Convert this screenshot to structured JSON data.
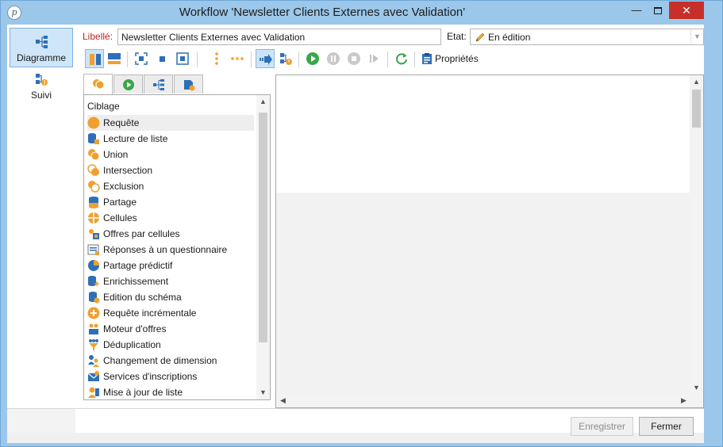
{
  "window": {
    "title": "Workflow 'Newsletter Clients Externes avec Validation'",
    "close_glyph": "✕",
    "minimize_glyph": "—",
    "app_icon_glyph": "p"
  },
  "leftnav": {
    "items": [
      {
        "label": "Diagramme",
        "icon": "workflow-diagram-icon",
        "active": true
      },
      {
        "label": "Suivi",
        "icon": "tracking-icon",
        "active": false
      }
    ]
  },
  "header": {
    "libelle_label": "Libellé:",
    "libelle_value": "Newsletter Clients Externes avec Validation",
    "etat_label": "Etat:",
    "etat_value": "En édition",
    "etat_icon": "pencil-icon"
  },
  "toolbar": {
    "properties_label": "Propriétés",
    "buttons": [
      "vertical-layout-icon",
      "horizontal-layout-icon",
      "zoom-fit-icon",
      "stop-square-icon",
      "zoom-selection-icon",
      "vertical-dots-icon",
      "horizontal-dots-icon",
      "step-arrow-icon",
      "activity-warning-icon",
      "play-icon",
      "pause-icon",
      "stop-icon",
      "next-icon",
      "refresh-icon",
      "properties-icon"
    ]
  },
  "palette": {
    "tabs": [
      "targeting-tab-icon",
      "flow-control-tab-icon",
      "actions-tab-icon",
      "events-tab-icon"
    ],
    "section_title": "Ciblage",
    "items": [
      {
        "label": "Requête",
        "icon": "query-icon"
      },
      {
        "label": "Lecture de liste",
        "icon": "list-read-icon"
      },
      {
        "label": "Union",
        "icon": "union-icon"
      },
      {
        "label": "Intersection",
        "icon": "intersection-icon"
      },
      {
        "label": "Exclusion",
        "icon": "exclusion-icon"
      },
      {
        "label": "Partage",
        "icon": "split-icon"
      },
      {
        "label": "Cellules",
        "icon": "cells-icon"
      },
      {
        "label": "Offres par cellules",
        "icon": "offers-by-cell-icon"
      },
      {
        "label": "Réponses à un questionnaire",
        "icon": "survey-answers-icon"
      },
      {
        "label": "Partage prédictif",
        "icon": "predictive-split-icon"
      },
      {
        "label": "Enrichissement",
        "icon": "enrichment-icon"
      },
      {
        "label": "Edition du schéma",
        "icon": "schema-edit-icon"
      },
      {
        "label": "Requête incrémentale",
        "icon": "incremental-query-icon"
      },
      {
        "label": "Moteur d'offres",
        "icon": "offer-engine-icon"
      },
      {
        "label": "Déduplication",
        "icon": "deduplication-icon"
      },
      {
        "label": "Changement de dimension",
        "icon": "change-dimension-icon"
      },
      {
        "label": "Services d'inscriptions",
        "icon": "subscription-services-icon"
      },
      {
        "label": "Mise à jour de liste",
        "icon": "list-update-icon"
      }
    ]
  },
  "footer": {
    "save_label": "Enregistrer",
    "close_label": "Fermer"
  },
  "colors": {
    "accent": "#f0a030",
    "title_bar": "#9bc7ea",
    "close_button": "#c7302a",
    "libelle_label": "#c02424",
    "play_green": "#3aa64a"
  }
}
